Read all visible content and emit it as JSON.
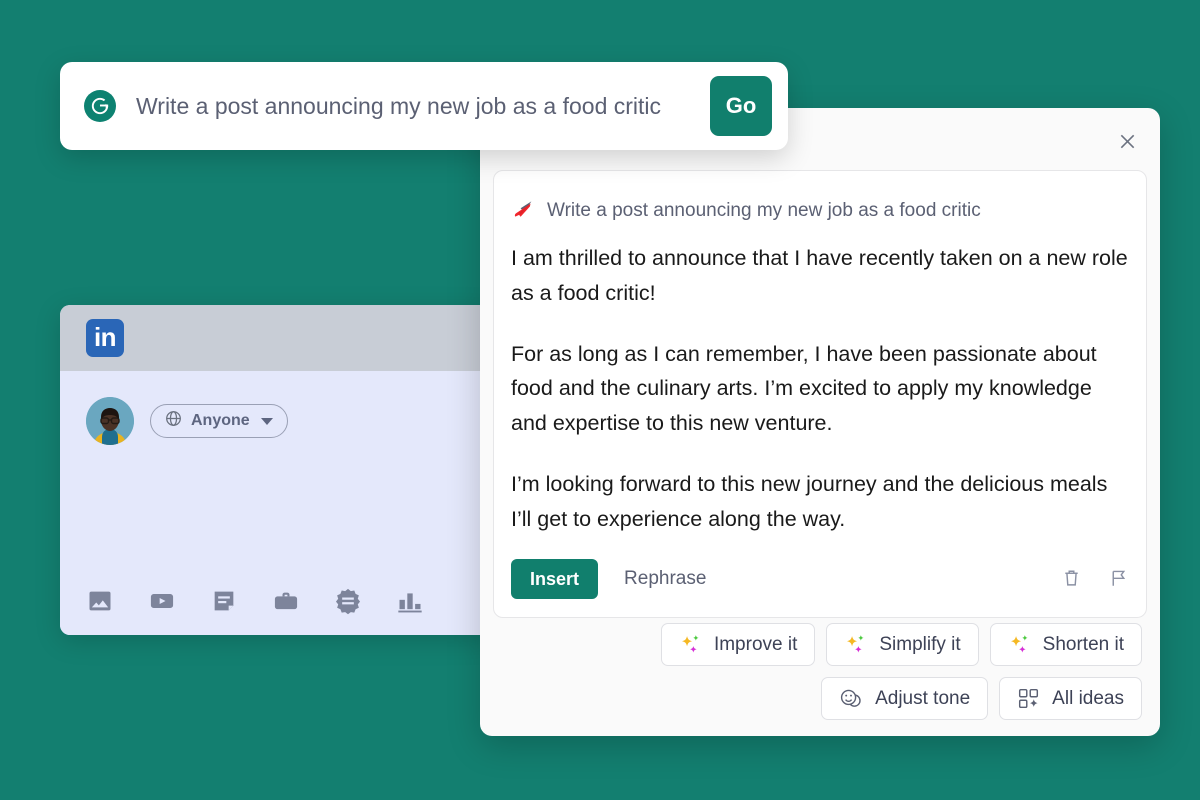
{
  "theme": {
    "background": "#137f70",
    "brand_green": "#117f6d",
    "linkedin_blue": "#2a66b7",
    "sparkle_gold": "#f5b823",
    "sparkle_green": "#4cc93f",
    "sparkle_magenta": "#d62fd6",
    "marker_red": "#f0262d",
    "text_dark": "#1a1a1a",
    "text_muted": "#5b6073"
  },
  "prompt_bar": {
    "logo_icon": "grammarly-g-icon",
    "value": "Write a post announcing my new job as a food critic",
    "placeholder": "Write a post announcing my new job as a food critic",
    "go_label": "Go"
  },
  "panel": {
    "close_icon": "close-icon",
    "prompt_echo": {
      "icon": "red-marker-icon",
      "text": "Write a post announcing my new job as a food critic"
    },
    "output": {
      "paragraph_1": "I am thrilled to announce that I have recently taken on a new role as a food critic!",
      "paragraph_2": "For as long as I can remember, I have been passionate about food and the culinary arts. I’m excited to apply my knowledge and expertise to this new venture.",
      "paragraph_3": "I’m looking forward to this new journey and the delicious meals I’ll get to experience along the way."
    },
    "actions": {
      "insert_label": "Insert",
      "rephrase_label": "Rephrase",
      "delete_icon": "trash-icon",
      "flag_icon": "flag-icon"
    },
    "chips": [
      {
        "icon": "sparkle-icon",
        "label": "Improve it"
      },
      {
        "icon": "sparkle-icon",
        "label": "Simplify it"
      },
      {
        "icon": "sparkle-icon",
        "label": "Shorten it"
      },
      {
        "icon": "smiley-faces-icon",
        "label": "Adjust tone"
      },
      {
        "icon": "grid-sparkle-icon",
        "label": "All ideas"
      }
    ]
  },
  "linkedin": {
    "logo_text": "in",
    "logo_icon": "linkedin-logo-icon",
    "avatar_icon": "user-avatar",
    "audience": {
      "icon": "globe-icon",
      "label": "Anyone",
      "caret_icon": "chevron-down-icon"
    },
    "toolbar": [
      {
        "icon": "photo-icon",
        "name": "add-photo"
      },
      {
        "icon": "video-icon",
        "name": "add-video"
      },
      {
        "icon": "document-icon",
        "name": "write-article"
      },
      {
        "icon": "briefcase-icon",
        "name": "share-job"
      },
      {
        "icon": "celebrate-badge-icon",
        "name": "celebrate-occasion"
      },
      {
        "icon": "bar-chart-icon",
        "name": "create-poll"
      }
    ]
  }
}
